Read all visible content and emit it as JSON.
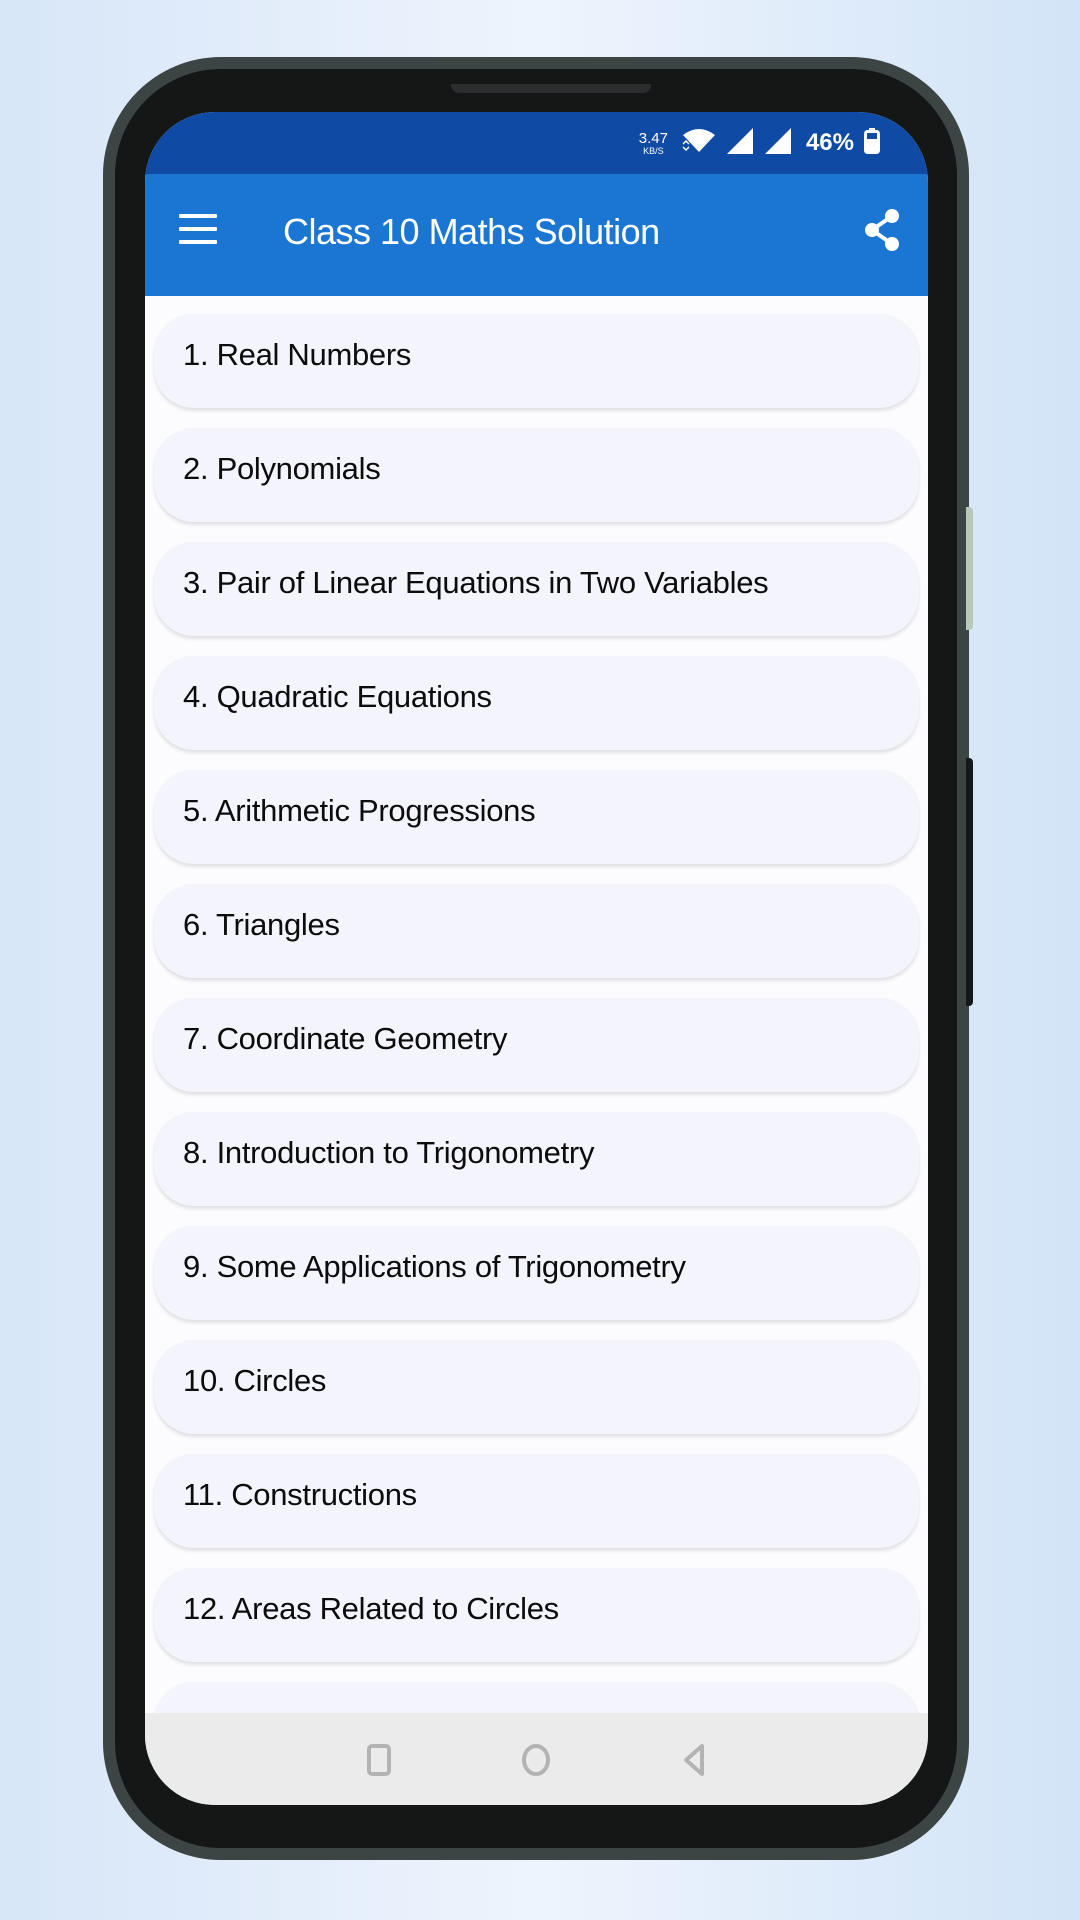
{
  "status_bar": {
    "net_speed_value": "3.47",
    "net_speed_unit": "KB/S",
    "icons": [
      "wifi-icon",
      "signal-icon",
      "signal-icon",
      "battery-icon"
    ],
    "battery_percent": "46%"
  },
  "app_bar": {
    "title": "Class 10 Maths Solution",
    "menu_icon": "hamburger-menu-icon",
    "share_icon": "share-icon",
    "background_color": "#1b76d3",
    "status_color": "#0f4aa5"
  },
  "chapters": [
    {
      "label": "1. Real Numbers"
    },
    {
      "label": "2. Polynomials"
    },
    {
      "label": "3. Pair of Linear Equations in Two Variables"
    },
    {
      "label": "4. Quadratic Equations"
    },
    {
      "label": "5. Arithmetic Progressions"
    },
    {
      "label": "6. Triangles"
    },
    {
      "label": "7. Coordinate Geometry"
    },
    {
      "label": "8. Introduction to Trigonometry"
    },
    {
      "label": "9. Some Applications of Trigonometry"
    },
    {
      "label": "10. Circles"
    },
    {
      "label": "11. Constructions"
    },
    {
      "label": "12. Areas Related to Circles"
    }
  ],
  "nav_bar": {
    "buttons": [
      "recents-square-icon",
      "home-circle-icon",
      "back-triangle-icon"
    ]
  }
}
